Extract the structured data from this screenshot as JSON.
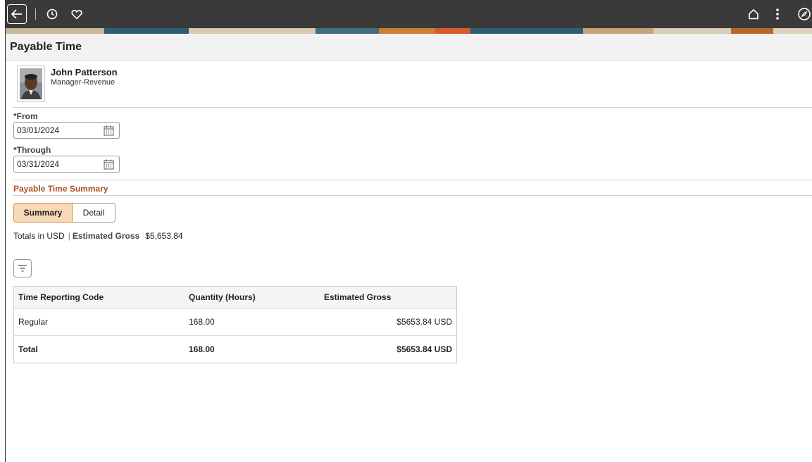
{
  "header": {
    "icons": [
      "back-icon",
      "history-icon",
      "favorite-icon",
      "home-icon",
      "more-icon",
      "navigator-icon"
    ]
  },
  "page": {
    "title": "Payable Time"
  },
  "employee": {
    "name": "John Patterson",
    "title": "Manager-Revenue"
  },
  "from": {
    "label": "*From",
    "value": "03/01/2024"
  },
  "through": {
    "label": "*Through",
    "value": "03/31/2024"
  },
  "summary": {
    "section_title": "Payable Time Summary",
    "tabs": {
      "summary": "Summary",
      "detail": "Detail"
    },
    "totals_label": "Totals in USD",
    "estimated_gross_label": "Estimated Gross",
    "estimated_gross_value": "$5,653.84"
  },
  "table": {
    "headers": [
      "Time Reporting Code",
      "Quantity (Hours)",
      "Estimated Gross"
    ],
    "rows": [
      [
        "Regular",
        "168.00",
        "$5653.84 USD"
      ]
    ],
    "total": [
      "Total",
      "168.00",
      "$5653.84 USD"
    ]
  },
  "colors": {
    "accent": "#a9512a",
    "selected_tab": "#f7d9b8",
    "banner": "#3a3a3a"
  }
}
